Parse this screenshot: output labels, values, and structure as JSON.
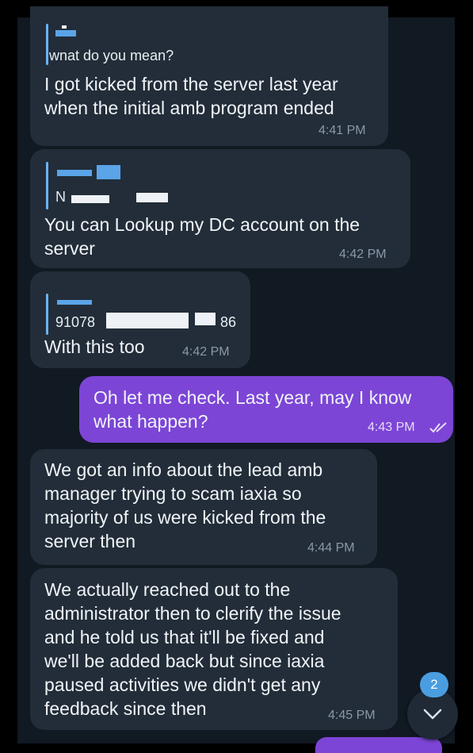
{
  "messages": [
    {
      "id": "m1",
      "reply_preview": "wnat do you mean?",
      "text": "I got kicked from the server last year\nwhen the initial amb program ended",
      "time": "4:41 PM"
    },
    {
      "id": "m2",
      "reply_preview": "N",
      "text": "You can Lookup my DC account on the\nserver",
      "time": "4:42 PM"
    },
    {
      "id": "m3",
      "reply_preview_start": "91078",
      "reply_preview_end": "86",
      "text": "With this too",
      "time": "4:42 PM"
    },
    {
      "id": "m4",
      "outgoing": true,
      "text": "Oh let me check. Last year, may I know\nwhat happen?",
      "time": "4:43 PM"
    },
    {
      "id": "m5",
      "text": "We got an info about the lead amb\nmanager trying to scam iaxia so\nmajority of us were kicked from the\nserver then",
      "time": "4:44 PM"
    },
    {
      "id": "m6",
      "text": "We actually reached out to the\nadministrator then to clerify the issue\nand he told us that it'll be fixed and\nwe'll be added back but since iaxia\npaused activities we didn't get any\nfeedback since then",
      "time": "4:45 PM"
    }
  ],
  "scroll_down": {
    "unread_count": "2",
    "icon": "chevron-down-icon"
  },
  "colors": {
    "background": "#111923",
    "incoming_bubble": "#222d39",
    "outgoing_bubble": "#7c45d6",
    "reply_accent": "#6ab4f0",
    "badge": "#4a9ee0"
  }
}
